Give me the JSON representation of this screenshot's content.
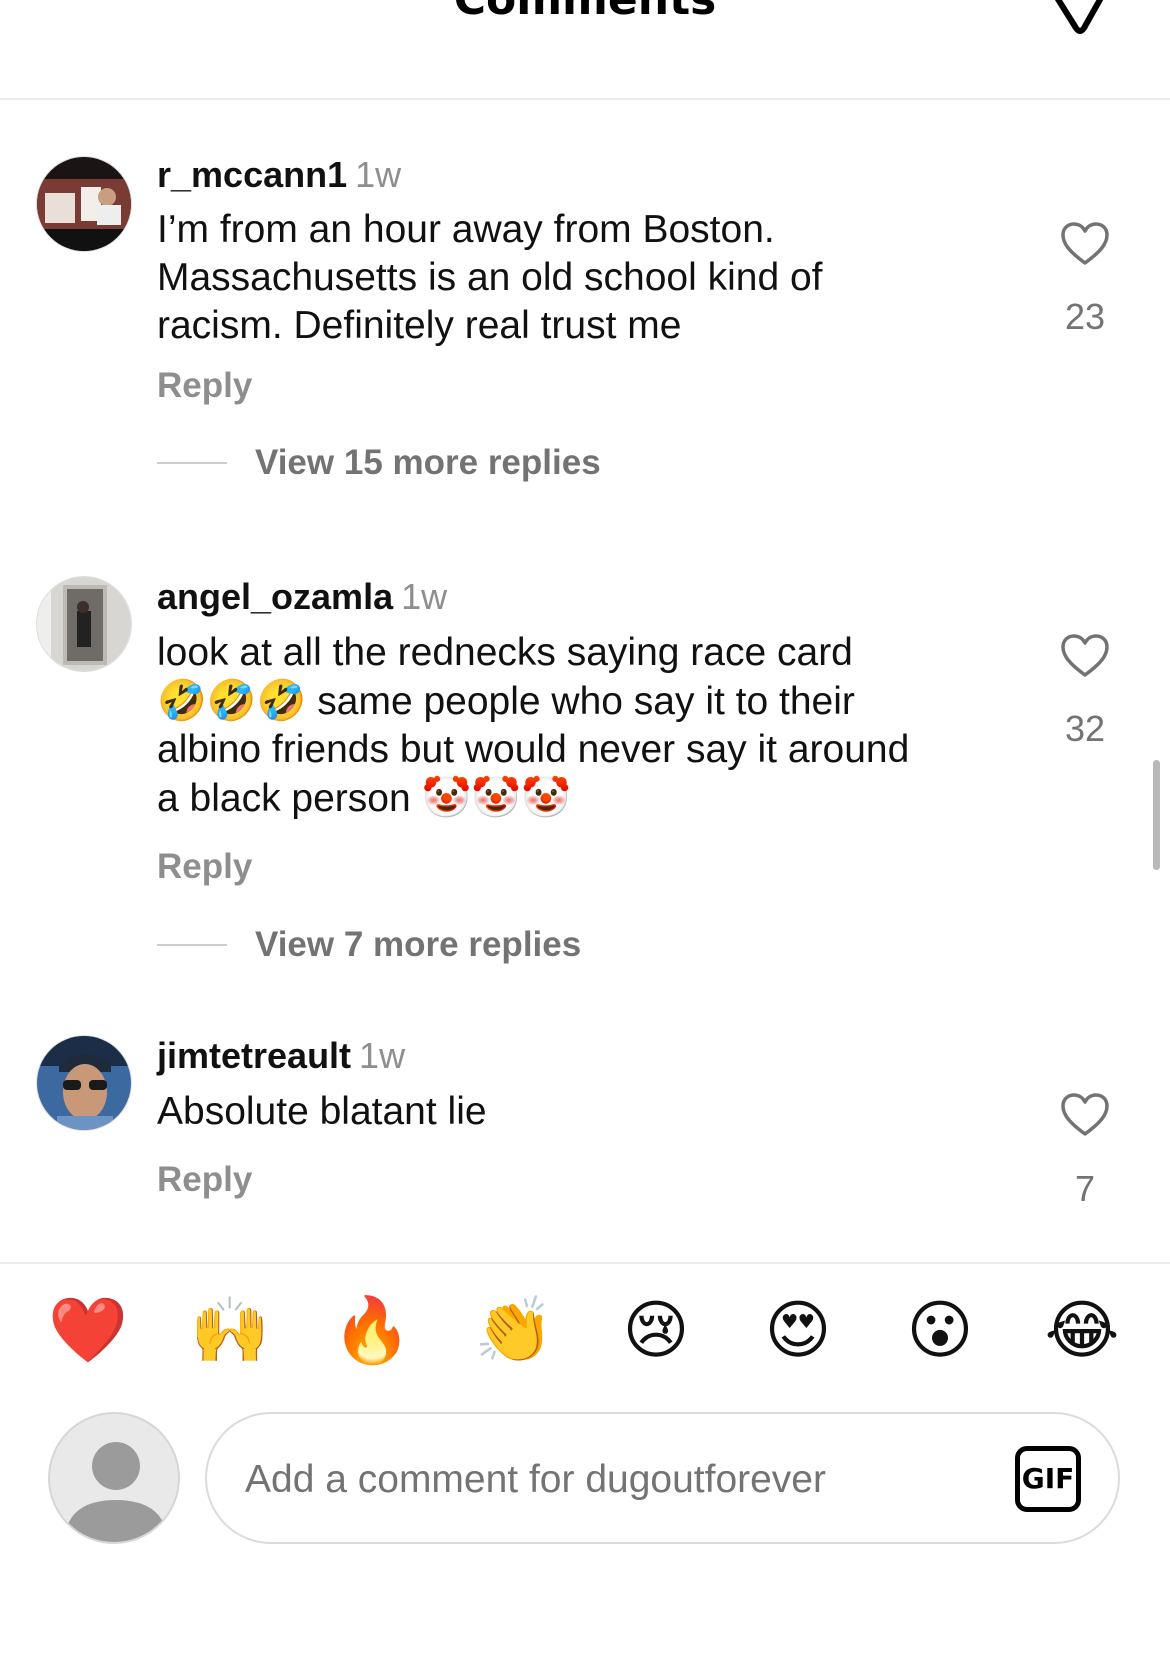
{
  "header": {
    "title": "Comments",
    "icon": "filter-icon"
  },
  "comments": [
    {
      "username": "r_mccann1",
      "time": "1w",
      "lines": [
        "I’m from an hour away from Boston.",
        "Massachusetts is an old school kind of",
        "racism. Definitely real trust me"
      ],
      "reply_label": "Reply",
      "view_more_label": "View 15 more replies",
      "likes": "23"
    },
    {
      "username": "angel_ozamla",
      "time": "1w",
      "line1": "look at all the rednecks saying race card",
      "line2_emoji": "🤣🤣🤣",
      "line2_text": "same people who say it to their",
      "line3": "albino friends but would never say it around",
      "line4_text": "a black person",
      "line4_emoji": "🤡🤡🤡",
      "reply_label": "Reply",
      "view_more_label": "View 7 more replies",
      "likes": "32"
    },
    {
      "username": "jimtetreault",
      "time": "1w",
      "text": "Absolute blatant lie",
      "reply_label": "Reply",
      "likes": "7"
    }
  ],
  "reactions": [
    "❤️",
    "🙌",
    "🔥",
    "👏",
    "😢",
    "😍",
    "😮",
    "😂"
  ],
  "composer": {
    "placeholder": "Add a comment for dugoutforever",
    "gif_label": "GIF"
  }
}
